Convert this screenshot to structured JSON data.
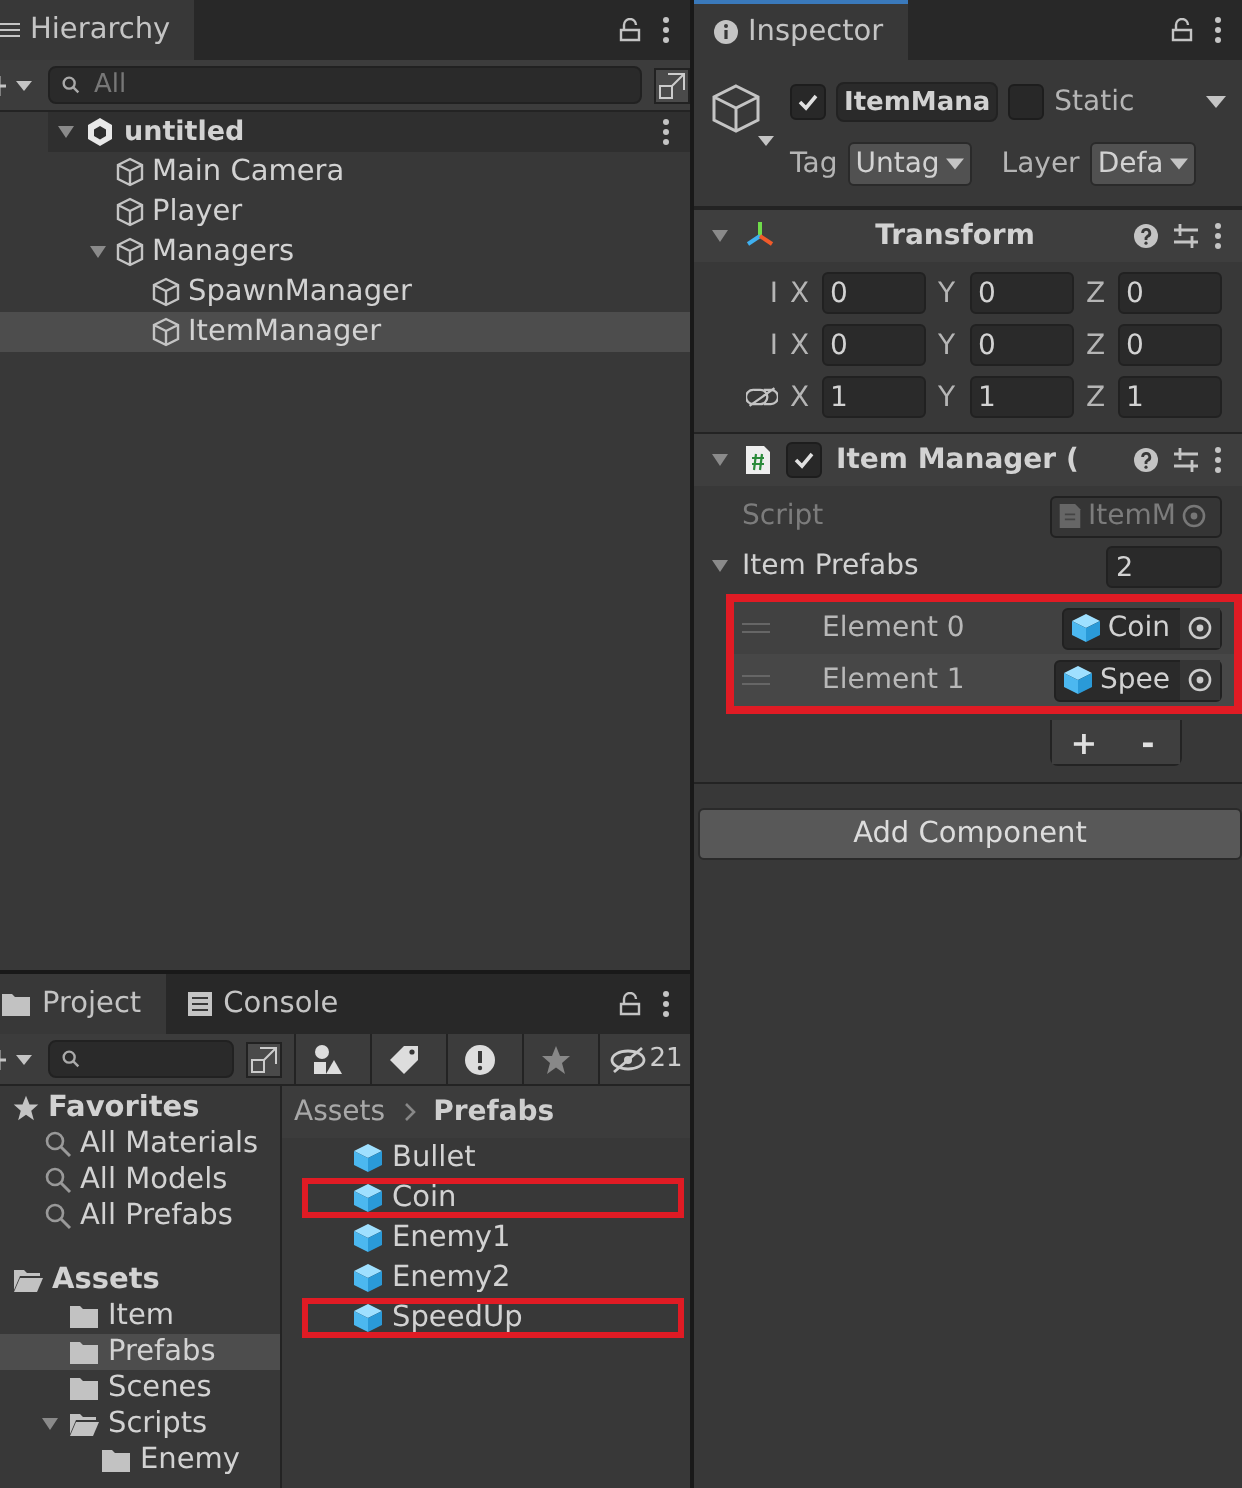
{
  "hierarchy": {
    "tab": "Hierarchy",
    "search": {
      "placeholder": "All"
    },
    "scene": {
      "name": "untitled",
      "expanded": true,
      "children": [
        {
          "name": "Main Camera",
          "selected": false
        },
        {
          "name": "Player",
          "selected": false
        },
        {
          "name": "Managers",
          "selected": false,
          "expanded": true,
          "children": [
            {
              "name": "SpawnManager",
              "selected": false
            },
            {
              "name": "ItemManager",
              "selected": true
            }
          ]
        }
      ]
    }
  },
  "inspector": {
    "tab": "Inspector",
    "object": {
      "active": true,
      "name": "ItemMana",
      "static": false,
      "static_label": "Static",
      "tag_label": "Tag",
      "tag": "Untag",
      "layer_label": "Layer",
      "layer": "Defa"
    },
    "transform": {
      "title": "Transform",
      "expanded": true,
      "rows": [
        {
          "kind": "plain",
          "label": "I",
          "values": [
            {
              "axis": "X",
              "value": "0"
            },
            {
              "axis": "Y",
              "value": "0"
            },
            {
              "axis": "Z",
              "value": "0"
            }
          ]
        },
        {
          "kind": "plain",
          "label": "I",
          "values": [
            {
              "axis": "X",
              "value": "0"
            },
            {
              "axis": "Y",
              "value": "0"
            },
            {
              "axis": "Z",
              "value": "0"
            }
          ]
        },
        {
          "kind": "link",
          "values": [
            {
              "axis": "X",
              "value": "1"
            },
            {
              "axis": "Y",
              "value": "1"
            },
            {
              "axis": "Z",
              "value": "1"
            }
          ]
        }
      ]
    },
    "script_component": {
      "title": "Item Manager (",
      "enabled": true,
      "expanded": true,
      "script_label": "Script",
      "script": "ItemM",
      "list": {
        "label": "Item Prefabs",
        "expanded": true,
        "count": "2",
        "highlighted": true,
        "elements": [
          {
            "label": "Element 0",
            "value": "Coin"
          },
          {
            "label": "Element 1",
            "value": "Spee"
          }
        ],
        "add": "+",
        "remove": "-"
      }
    },
    "add_component": "Add Component"
  },
  "project": {
    "tabs": [
      {
        "label": "Project",
        "selected": true
      },
      {
        "label": "Console",
        "selected": false
      }
    ],
    "hidden_count": "21",
    "favorites": {
      "label": "Favorites",
      "items": [
        "All Materials",
        "All Models",
        "All Prefabs"
      ]
    },
    "assets": {
      "label": "Assets",
      "expanded": true,
      "children": [
        {
          "name": "Item",
          "selected": false
        },
        {
          "name": "Prefabs",
          "selected": true
        },
        {
          "name": "Scenes",
          "selected": false
        },
        {
          "name": "Scripts",
          "selected": false,
          "expanded": true,
          "children": [
            {
              "name": "Enemy",
              "selected": false
            }
          ]
        }
      ]
    },
    "breadcrumb": [
      "Assets",
      "Prefabs"
    ],
    "files": [
      {
        "name": "Bullet",
        "highlighted": false
      },
      {
        "name": "Coin",
        "highlighted": true
      },
      {
        "name": "Enemy1",
        "highlighted": false
      },
      {
        "name": "Enemy2",
        "highlighted": false
      },
      {
        "name": "SpeedUp",
        "highlighted": true
      }
    ]
  }
}
